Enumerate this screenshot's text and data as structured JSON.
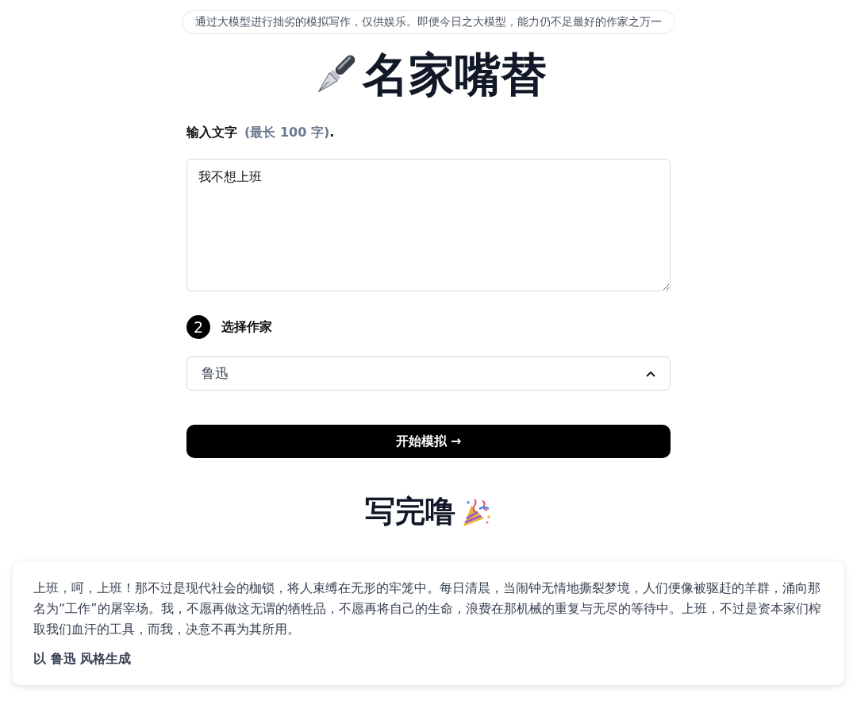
{
  "notice": "通过大模型进行拙劣的模拟写作，仅供娱乐。即便今日之大模型，能力仍不足最好的作家之万一",
  "title": "名家嘴替",
  "input": {
    "label": "输入文字",
    "hint": "(最长 100 字)",
    "suffix": ".",
    "value": "我不想上班"
  },
  "step": {
    "number": "2",
    "label": "选择作家"
  },
  "select": {
    "value": "鲁迅",
    "expanded": true
  },
  "submit": {
    "label": "开始模拟 →"
  },
  "result": {
    "heading": "写完噜",
    "text": "上班，呵，上班！那不过是现代社会的枷锁，将人束缚在无形的牢笼中。每日清晨，当闹钟无情地撕裂梦境，人们便像被驱赶的羊群，涌向那名为“工作”的屠宰场。我，不愿再做这无谓的牺牲品，不愿再将自己的生命，浪费在那机械的重复与无尽的等待中。上班，不过是资本家们榨取我们血汗的工具，而我，决意不再为其所用。",
    "credit": "以 鲁迅 风格生成"
  }
}
